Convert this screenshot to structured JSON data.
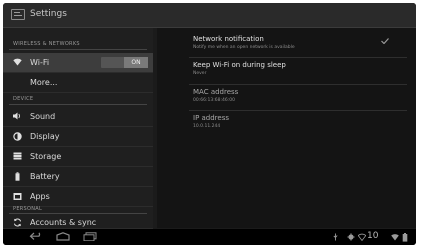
{
  "app": {
    "title": "Settings",
    "icon": "settings-app-icon"
  },
  "sidebar": {
    "sections": [
      {
        "header": "WIRELESS & NETWORKS",
        "items": [
          {
            "label": "Wi-Fi",
            "icon": "wifi-icon",
            "selected": true,
            "toggle": "ON"
          },
          {
            "label": "More...",
            "icon": null,
            "selected": false
          }
        ]
      },
      {
        "header": "DEVICE",
        "items": [
          {
            "label": "Sound",
            "icon": "speaker-icon"
          },
          {
            "label": "Display",
            "icon": "display-icon"
          },
          {
            "label": "Storage",
            "icon": "storage-icon"
          },
          {
            "label": "Battery",
            "icon": "battery-icon"
          },
          {
            "label": "Apps",
            "icon": "apps-icon"
          }
        ]
      },
      {
        "header": "PERSONAL",
        "items": [
          {
            "label": "Accounts & sync",
            "icon": "sync-icon"
          }
        ]
      }
    ]
  },
  "main": {
    "settings": [
      {
        "title": "Network notification",
        "subtitle": "Notify me when an open network is available",
        "checked": true
      },
      {
        "title": "Keep Wi-Fi on during sleep",
        "subtitle": "Never"
      },
      {
        "title": "MAC address",
        "subtitle": "00:66:13:68:46:00"
      },
      {
        "title": "IP address",
        "subtitle": "10.0.11.244"
      }
    ]
  },
  "statusbar": {
    "clock": "10",
    "icons": [
      "usb-icon",
      "android-debug-icon",
      "wifi-signal-icon",
      "battery-status-icon"
    ]
  },
  "navbar": {
    "buttons": [
      "back-button",
      "home-button",
      "recent-apps-button"
    ]
  },
  "colors": {
    "background": "#1b1b1b",
    "selected_item": "#3d3d3d",
    "text_primary": "#e2e2e2",
    "text_secondary": "#8c8c8c"
  }
}
